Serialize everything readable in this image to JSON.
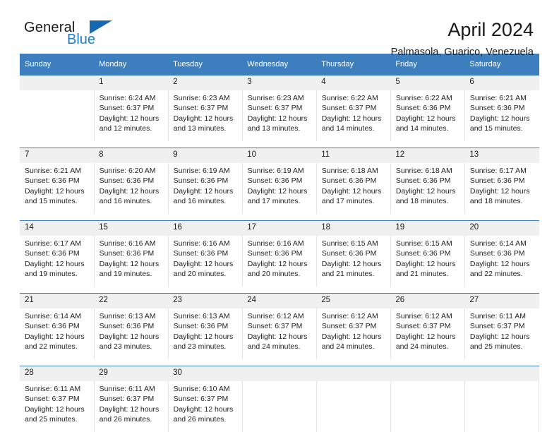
{
  "brand": {
    "name_part1": "General",
    "name_part2": "Blue",
    "accent_color": "#1d7fc4",
    "triangle_color": "#1669b0"
  },
  "header": {
    "title": "April 2024",
    "subtitle": "Palmasola, Guarico, Venezuela",
    "header_bar_color": "#3d7ebf"
  },
  "weekday_headers": [
    "Sunday",
    "Monday",
    "Tuesday",
    "Wednesday",
    "Thursday",
    "Friday",
    "Saturday"
  ],
  "weeks": [
    {
      "days": [
        {
          "date": "",
          "sunrise": "",
          "sunset": "",
          "daylight_line1": "",
          "daylight_line2": ""
        },
        {
          "date": "1",
          "sunrise": "Sunrise: 6:24 AM",
          "sunset": "Sunset: 6:37 PM",
          "daylight_line1": "Daylight: 12 hours",
          "daylight_line2": "and 12 minutes."
        },
        {
          "date": "2",
          "sunrise": "Sunrise: 6:23 AM",
          "sunset": "Sunset: 6:37 PM",
          "daylight_line1": "Daylight: 12 hours",
          "daylight_line2": "and 13 minutes."
        },
        {
          "date": "3",
          "sunrise": "Sunrise: 6:23 AM",
          "sunset": "Sunset: 6:37 PM",
          "daylight_line1": "Daylight: 12 hours",
          "daylight_line2": "and 13 minutes."
        },
        {
          "date": "4",
          "sunrise": "Sunrise: 6:22 AM",
          "sunset": "Sunset: 6:37 PM",
          "daylight_line1": "Daylight: 12 hours",
          "daylight_line2": "and 14 minutes."
        },
        {
          "date": "5",
          "sunrise": "Sunrise: 6:22 AM",
          "sunset": "Sunset: 6:36 PM",
          "daylight_line1": "Daylight: 12 hours",
          "daylight_line2": "and 14 minutes."
        },
        {
          "date": "6",
          "sunrise": "Sunrise: 6:21 AM",
          "sunset": "Sunset: 6:36 PM",
          "daylight_line1": "Daylight: 12 hours",
          "daylight_line2": "and 15 minutes."
        }
      ]
    },
    {
      "days": [
        {
          "date": "7",
          "sunrise": "Sunrise: 6:21 AM",
          "sunset": "Sunset: 6:36 PM",
          "daylight_line1": "Daylight: 12 hours",
          "daylight_line2": "and 15 minutes."
        },
        {
          "date": "8",
          "sunrise": "Sunrise: 6:20 AM",
          "sunset": "Sunset: 6:36 PM",
          "daylight_line1": "Daylight: 12 hours",
          "daylight_line2": "and 16 minutes."
        },
        {
          "date": "9",
          "sunrise": "Sunrise: 6:19 AM",
          "sunset": "Sunset: 6:36 PM",
          "daylight_line1": "Daylight: 12 hours",
          "daylight_line2": "and 16 minutes."
        },
        {
          "date": "10",
          "sunrise": "Sunrise: 6:19 AM",
          "sunset": "Sunset: 6:36 PM",
          "daylight_line1": "Daylight: 12 hours",
          "daylight_line2": "and 17 minutes."
        },
        {
          "date": "11",
          "sunrise": "Sunrise: 6:18 AM",
          "sunset": "Sunset: 6:36 PM",
          "daylight_line1": "Daylight: 12 hours",
          "daylight_line2": "and 17 minutes."
        },
        {
          "date": "12",
          "sunrise": "Sunrise: 6:18 AM",
          "sunset": "Sunset: 6:36 PM",
          "daylight_line1": "Daylight: 12 hours",
          "daylight_line2": "and 18 minutes."
        },
        {
          "date": "13",
          "sunrise": "Sunrise: 6:17 AM",
          "sunset": "Sunset: 6:36 PM",
          "daylight_line1": "Daylight: 12 hours",
          "daylight_line2": "and 18 minutes."
        }
      ]
    },
    {
      "days": [
        {
          "date": "14",
          "sunrise": "Sunrise: 6:17 AM",
          "sunset": "Sunset: 6:36 PM",
          "daylight_line1": "Daylight: 12 hours",
          "daylight_line2": "and 19 minutes."
        },
        {
          "date": "15",
          "sunrise": "Sunrise: 6:16 AM",
          "sunset": "Sunset: 6:36 PM",
          "daylight_line1": "Daylight: 12 hours",
          "daylight_line2": "and 19 minutes."
        },
        {
          "date": "16",
          "sunrise": "Sunrise: 6:16 AM",
          "sunset": "Sunset: 6:36 PM",
          "daylight_line1": "Daylight: 12 hours",
          "daylight_line2": "and 20 minutes."
        },
        {
          "date": "17",
          "sunrise": "Sunrise: 6:16 AM",
          "sunset": "Sunset: 6:36 PM",
          "daylight_line1": "Daylight: 12 hours",
          "daylight_line2": "and 20 minutes."
        },
        {
          "date": "18",
          "sunrise": "Sunrise: 6:15 AM",
          "sunset": "Sunset: 6:36 PM",
          "daylight_line1": "Daylight: 12 hours",
          "daylight_line2": "and 21 minutes."
        },
        {
          "date": "19",
          "sunrise": "Sunrise: 6:15 AM",
          "sunset": "Sunset: 6:36 PM",
          "daylight_line1": "Daylight: 12 hours",
          "daylight_line2": "and 21 minutes."
        },
        {
          "date": "20",
          "sunrise": "Sunrise: 6:14 AM",
          "sunset": "Sunset: 6:36 PM",
          "daylight_line1": "Daylight: 12 hours",
          "daylight_line2": "and 22 minutes."
        }
      ]
    },
    {
      "days": [
        {
          "date": "21",
          "sunrise": "Sunrise: 6:14 AM",
          "sunset": "Sunset: 6:36 PM",
          "daylight_line1": "Daylight: 12 hours",
          "daylight_line2": "and 22 minutes."
        },
        {
          "date": "22",
          "sunrise": "Sunrise: 6:13 AM",
          "sunset": "Sunset: 6:36 PM",
          "daylight_line1": "Daylight: 12 hours",
          "daylight_line2": "and 23 minutes."
        },
        {
          "date": "23",
          "sunrise": "Sunrise: 6:13 AM",
          "sunset": "Sunset: 6:36 PM",
          "daylight_line1": "Daylight: 12 hours",
          "daylight_line2": "and 23 minutes."
        },
        {
          "date": "24",
          "sunrise": "Sunrise: 6:12 AM",
          "sunset": "Sunset: 6:37 PM",
          "daylight_line1": "Daylight: 12 hours",
          "daylight_line2": "and 24 minutes."
        },
        {
          "date": "25",
          "sunrise": "Sunrise: 6:12 AM",
          "sunset": "Sunset: 6:37 PM",
          "daylight_line1": "Daylight: 12 hours",
          "daylight_line2": "and 24 minutes."
        },
        {
          "date": "26",
          "sunrise": "Sunrise: 6:12 AM",
          "sunset": "Sunset: 6:37 PM",
          "daylight_line1": "Daylight: 12 hours",
          "daylight_line2": "and 24 minutes."
        },
        {
          "date": "27",
          "sunrise": "Sunrise: 6:11 AM",
          "sunset": "Sunset: 6:37 PM",
          "daylight_line1": "Daylight: 12 hours",
          "daylight_line2": "and 25 minutes."
        }
      ]
    },
    {
      "days": [
        {
          "date": "28",
          "sunrise": "Sunrise: 6:11 AM",
          "sunset": "Sunset: 6:37 PM",
          "daylight_line1": "Daylight: 12 hours",
          "daylight_line2": "and 25 minutes."
        },
        {
          "date": "29",
          "sunrise": "Sunrise: 6:11 AM",
          "sunset": "Sunset: 6:37 PM",
          "daylight_line1": "Daylight: 12 hours",
          "daylight_line2": "and 26 minutes."
        },
        {
          "date": "30",
          "sunrise": "Sunrise: 6:10 AM",
          "sunset": "Sunset: 6:37 PM",
          "daylight_line1": "Daylight: 12 hours",
          "daylight_line2": "and 26 minutes."
        },
        {
          "date": "",
          "sunrise": "",
          "sunset": "",
          "daylight_line1": "",
          "daylight_line2": ""
        },
        {
          "date": "",
          "sunrise": "",
          "sunset": "",
          "daylight_line1": "",
          "daylight_line2": ""
        },
        {
          "date": "",
          "sunrise": "",
          "sunset": "",
          "daylight_line1": "",
          "daylight_line2": ""
        },
        {
          "date": "",
          "sunrise": "",
          "sunset": "",
          "daylight_line1": "",
          "daylight_line2": ""
        }
      ]
    }
  ]
}
